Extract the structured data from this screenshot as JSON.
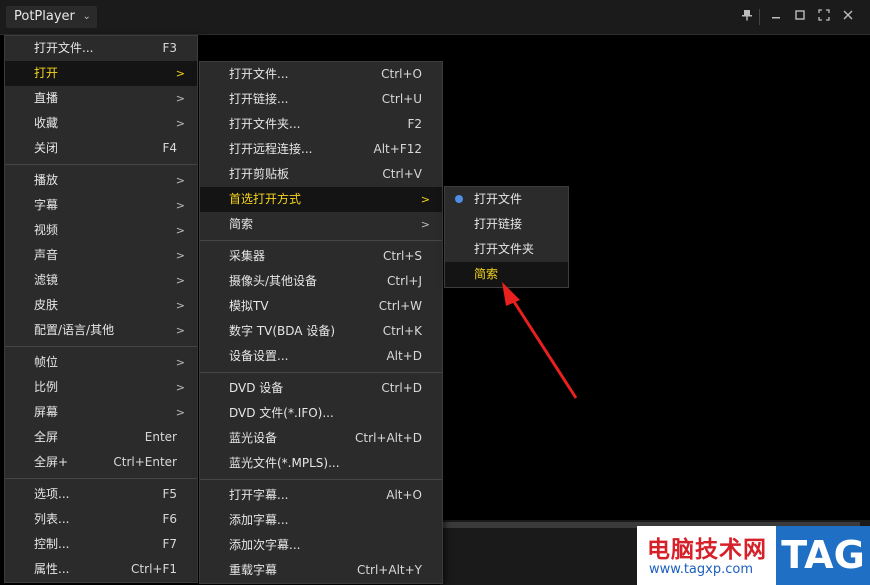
{
  "titlebar": {
    "app_name": "PotPlayer",
    "chevron": "⌄",
    "buttons": [
      "pin-icon",
      "minimize-icon",
      "maximize-icon",
      "fullscreen-icon",
      "close-icon"
    ]
  },
  "main_menu": {
    "groups": [
      [
        {
          "label": "打开文件...",
          "shortcut": "F3",
          "arrow": ""
        },
        {
          "label": "打开",
          "shortcut": "",
          "arrow": ">",
          "active": true
        },
        {
          "label": "直播",
          "shortcut": "",
          "arrow": ">"
        },
        {
          "label": "收藏",
          "shortcut": "",
          "arrow": ">"
        },
        {
          "label": "关闭",
          "shortcut": "F4",
          "arrow": ""
        }
      ],
      [
        {
          "label": "播放",
          "shortcut": "",
          "arrow": ">"
        },
        {
          "label": "字幕",
          "shortcut": "",
          "arrow": ">"
        },
        {
          "label": "视频",
          "shortcut": "",
          "arrow": ">"
        },
        {
          "label": "声音",
          "shortcut": "",
          "arrow": ">"
        },
        {
          "label": "滤镜",
          "shortcut": "",
          "arrow": ">"
        },
        {
          "label": "皮肤",
          "shortcut": "",
          "arrow": ">"
        },
        {
          "label": "配置/语言/其他",
          "shortcut": "",
          "arrow": ">"
        }
      ],
      [
        {
          "label": "帧位",
          "shortcut": "",
          "arrow": ">"
        },
        {
          "label": "比例",
          "shortcut": "",
          "arrow": ">"
        },
        {
          "label": "屏幕",
          "shortcut": "",
          "arrow": ">"
        },
        {
          "label": "全屏",
          "shortcut": "Enter",
          "arrow": ""
        },
        {
          "label": "全屏+",
          "shortcut": "Ctrl+Enter",
          "arrow": ""
        }
      ],
      [
        {
          "label": "选项...",
          "shortcut": "F5",
          "arrow": ""
        },
        {
          "label": "列表...",
          "shortcut": "F6",
          "arrow": ""
        },
        {
          "label": "控制...",
          "shortcut": "F7",
          "arrow": ""
        },
        {
          "label": "属性...",
          "shortcut": "Ctrl+F1",
          "arrow": ""
        }
      ]
    ]
  },
  "open_menu": {
    "groups": [
      [
        {
          "label": "打开文件...",
          "shortcut": "Ctrl+O",
          "arrow": ""
        },
        {
          "label": "打开链接...",
          "shortcut": "Ctrl+U",
          "arrow": ""
        },
        {
          "label": "打开文件夹...",
          "shortcut": "F2",
          "arrow": ""
        },
        {
          "label": "打开远程连接...",
          "shortcut": "Alt+F12",
          "arrow": ""
        },
        {
          "label": "打开剪贴板",
          "shortcut": "Ctrl+V",
          "arrow": ""
        },
        {
          "label": "首选打开方式",
          "shortcut": "",
          "arrow": ">",
          "active": true
        },
        {
          "label": "简索",
          "shortcut": "",
          "arrow": ">"
        }
      ],
      [
        {
          "label": "采集器",
          "shortcut": "Ctrl+S",
          "arrow": ""
        },
        {
          "label": "摄像头/其他设备",
          "shortcut": "Ctrl+J",
          "arrow": ""
        },
        {
          "label": "模拟TV",
          "shortcut": "Ctrl+W",
          "arrow": ""
        },
        {
          "label": "数字 TV(BDA 设备)",
          "shortcut": "Ctrl+K",
          "arrow": ""
        },
        {
          "label": "设备设置...",
          "shortcut": "Alt+D",
          "arrow": ""
        }
      ],
      [
        {
          "label": "DVD 设备",
          "shortcut": "Ctrl+D",
          "arrow": ""
        },
        {
          "label": "DVD 文件(*.IFO)...",
          "shortcut": "",
          "arrow": ""
        },
        {
          "label": "蓝光设备",
          "shortcut": "Ctrl+Alt+D",
          "arrow": ""
        },
        {
          "label": "蓝光文件(*.MPLS)...",
          "shortcut": "",
          "arrow": ""
        }
      ],
      [
        {
          "label": "打开字幕...",
          "shortcut": "Alt+O",
          "arrow": ""
        },
        {
          "label": "添加字幕...",
          "shortcut": "",
          "arrow": ""
        },
        {
          "label": "添加次字幕...",
          "shortcut": "",
          "arrow": ""
        },
        {
          "label": "重载字幕",
          "shortcut": "Ctrl+Alt+Y",
          "arrow": ""
        }
      ]
    ]
  },
  "preferred_menu": {
    "items": [
      {
        "label": "打开文件",
        "selected": true
      },
      {
        "label": "打开链接"
      },
      {
        "label": "打开文件夹"
      },
      {
        "label": "简索",
        "active": true
      }
    ]
  },
  "annotation": {
    "color": "#e8201e"
  },
  "watermark": {
    "site_name": "电脑技术网",
    "url": "www.tagxp.com",
    "logo": "TAG"
  },
  "colors": {
    "highlight_text": "#f5d41f",
    "menu_bg": "#2b2b2b",
    "radio": "#4d8fe6"
  }
}
